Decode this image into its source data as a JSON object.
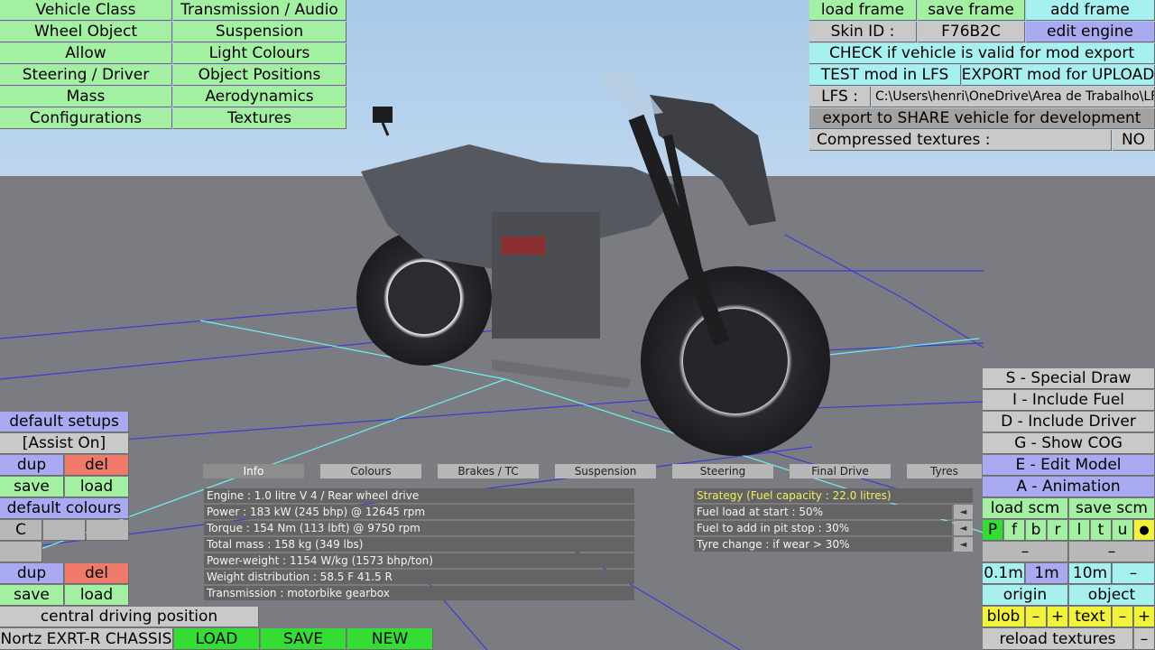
{
  "top_left_menu": {
    "col1": [
      "Vehicle Class",
      "Wheel Object",
      "Allow",
      "Steering / Driver",
      "Mass",
      "Configurations"
    ],
    "col2": [
      "Transmission / Audio",
      "Suspension",
      "Light Colours",
      "Object Positions",
      "Aerodynamics",
      "Textures"
    ]
  },
  "top_right": {
    "load_frame": "load frame",
    "save_frame": "save frame",
    "add_frame": "add frame",
    "skin_label": "Skin ID :",
    "skin_value": "F76B2C",
    "edit_engine": "edit engine",
    "check_valid": "CHECK if vehicle is valid for mod export",
    "test_mod": "TEST mod in LFS",
    "export_mod": "EXPORT mod for UPLOAD",
    "lfs_label": "LFS :",
    "lfs_path": "C:\\Users\\henri\\OneDrive\\Area de Trabalho\\LFS",
    "export_share": "export to SHARE vehicle for development",
    "compressed_label": "Compressed textures :",
    "compressed_value": "NO"
  },
  "left_panel": {
    "default_setups": "default setups",
    "assist": "[Assist On]",
    "dup": "dup",
    "del": "del",
    "save": "save",
    "load": "load",
    "default_colours": "default colours",
    "colour_c": "C",
    "dup2": "dup",
    "del2": "del",
    "save2": "save",
    "load2": "load",
    "central_driving": "central driving position"
  },
  "bottom_bar": {
    "chassis_name": "Nortz EXRT-R CHASSIS",
    "load": "LOAD",
    "save": "SAVE",
    "new": "NEW"
  },
  "tabs": [
    "Info",
    "Colours",
    "Brakes / TC",
    "Suspension",
    "Steering",
    "Final Drive",
    "Tyres"
  ],
  "info_rows": [
    "Engine : 1.0 litre V 4 / Rear wheel drive",
    "Power : 183 kW (245 bhp) @ 12645 rpm",
    "Torque : 154 Nm (113 lbft) @ 9750 rpm",
    "Total mass : 158 kg (349 lbs)",
    "Power-weight : 1154 W/kg (1573 bhp/ton)",
    "Weight distribution : 58.5 F  41.5 R",
    "Transmission : motorbike gearbox"
  ],
  "strategy": {
    "title": "Strategy (Fuel capacity : 22.0 litres)",
    "rows": [
      "Fuel load at start : 50%",
      "Fuel to add in pit stop : 30%",
      "Tyre change : if wear > 30%"
    ],
    "arrow": "◄"
  },
  "right_panel": {
    "special_draw": "S - Special Draw",
    "include_fuel": "I - Include Fuel",
    "include_driver": "D - Include Driver",
    "show_cog": "G - Show COG",
    "edit_model": "E - Edit Model",
    "animation": "A - Animation",
    "load_scm": "load scm",
    "save_scm": "save scm",
    "modes": [
      "P",
      "f",
      "b",
      "r",
      "l",
      "t",
      "u",
      "●"
    ],
    "dash1": "–",
    "dash2": "–",
    "step1": "0.1m",
    "step2": "1m",
    "step3": "10m",
    "step4": "–",
    "origin": "origin",
    "object": "object",
    "blob": "blob",
    "minus": "–",
    "plus": "+",
    "text": "text",
    "reload_textures": "reload textures",
    "reload_minus": "–"
  }
}
